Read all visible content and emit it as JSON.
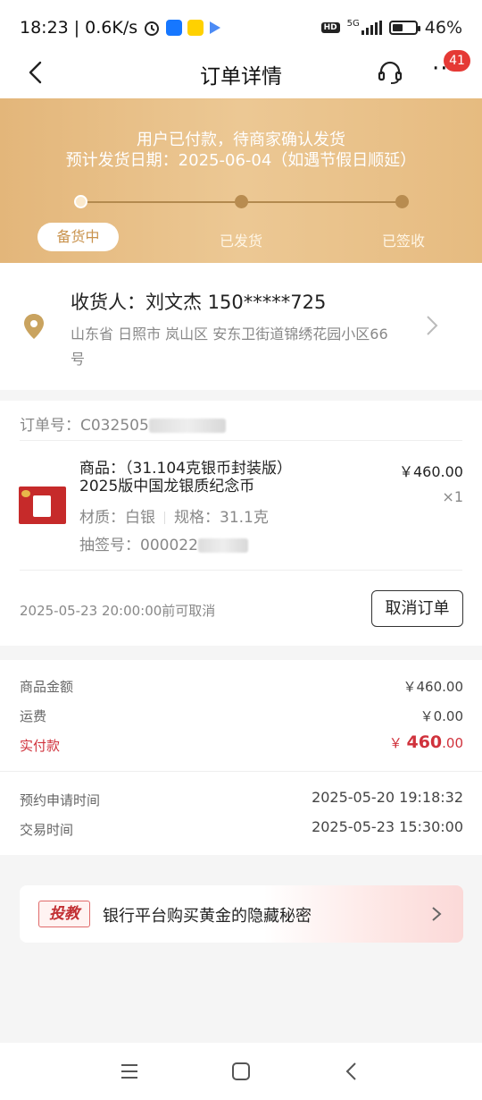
{
  "status_bar": {
    "time": "18:23",
    "speed": "0.6K/s",
    "network": "5G",
    "hd_label": "HD",
    "battery": "46%",
    "battery_level": 0.46
  },
  "nav": {
    "title": "订单详情",
    "badge_count": "41",
    "more_label": "···"
  },
  "banner": {
    "line1": "用户已付款，待商家确认发货",
    "line2": "预计发货日期：2025-06-04（如遇节假日顺延）",
    "steps": [
      "备货中",
      "已发货",
      "已签收"
    ],
    "current_step": 0,
    "colors": {
      "gold": "#e3b67a",
      "accent": "#c9934d"
    }
  },
  "address": {
    "receiver_line": "收货人：刘文杰 150*****725",
    "detail": "山东省 日照市 岚山区 安东卫街道锦绣花园小区66号"
  },
  "order": {
    "order_no_prefix": "订单号：C032505",
    "goods_name": "商品：（31.104克银币封装版）2025版中国龙银质纪念币",
    "material": "材质：白银",
    "spec": "规格：31.1克",
    "lottery_prefix": "抽签号：000022",
    "price": "￥460.00",
    "qty": "×1",
    "cancel_tip": "2025-05-23 20:00:00前可取消",
    "cancel_button": "取消订单"
  },
  "amounts": {
    "goods_label": "商品金额",
    "goods_value": "￥460.00",
    "shipping_label": "运费",
    "shipping_value": "￥0.00",
    "paid_label": "实付款",
    "paid_currency": "￥ ",
    "paid_int": "460",
    "paid_dec": ".00",
    "reserve_label": "预约申请时间",
    "reserve_value": "2025-05-20 19:18:32",
    "trade_label": "交易时间",
    "trade_value": "2025-05-23 15:30:00"
  },
  "promo": {
    "badge": "投教",
    "text": "银行平台购买黄金的隐藏秘密"
  },
  "home_bar": {
    "icons": [
      "menu-icon",
      "home-icon",
      "back-icon"
    ]
  }
}
